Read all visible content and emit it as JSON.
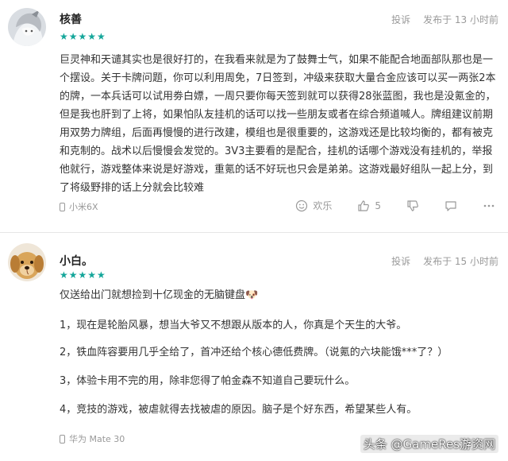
{
  "reviews": [
    {
      "username": "核善",
      "stars": "★★★★★",
      "report": "投诉",
      "published": "发布于 13 小时前",
      "body": "巨灵神和天谴其实也是很好打的，在我看来就是为了鼓舞士气，如果不能配合地面部队那也是一个摆设。关于卡牌问题，你可以利用周免，7日签到，冲级来获取大量合金应该可以买一两张2本的牌，一本兵话可以试用劵白嫖，一周只要你每天签到就可以获得28张蓝图，我也是没氪金的，但是我也肝到了上将，如果怕队友挂机的话可以找一些朋友或者在综合频道喊人。牌组建议前期用双势力牌组，后面再慢慢的进行改建，模组也是很重要的，这游戏还是比较均衡的，都有被克和克制的。战术以后慢慢会发觉的。3V3主要看的是配合，挂机的话哪个游戏没有挂机的，举报他就行，游戏整体来说是好游戏，重氪的话不好玩也只会是弟弟。这游戏最好组队一起上分，到了将级野排的话上分就会比较难",
      "device": "小米6X",
      "happy": "欢乐",
      "likes": "5"
    },
    {
      "username": "小白。",
      "stars": "★★★★★",
      "report": "投诉",
      "published": "发布于 15 小时前",
      "paragraphs": [
        "仅送给出门就想捡到十亿现金的无脑键盘🐶",
        "1，现在是轮胎风暴，想当大爷又不想跟从版本的人，你真是个天生的大爷。",
        "2，铁血阵容要用几乎全给了，首冲还给个核心德低费牌。（说氪的六块能饿***了？）",
        "3，体验卡用不完的用，除非您得了帕金森不知道自己要玩什么。",
        "4，竞技的游戏，被虐就得去找被虐的原因。脑子是个好东西，希望某些人有。"
      ],
      "device": "华为 Mate 30"
    }
  ],
  "watermark": "头条 @GameRes游资网",
  "colors": {
    "star": "#14a69a",
    "meta": "#999999",
    "text": "#333333"
  }
}
